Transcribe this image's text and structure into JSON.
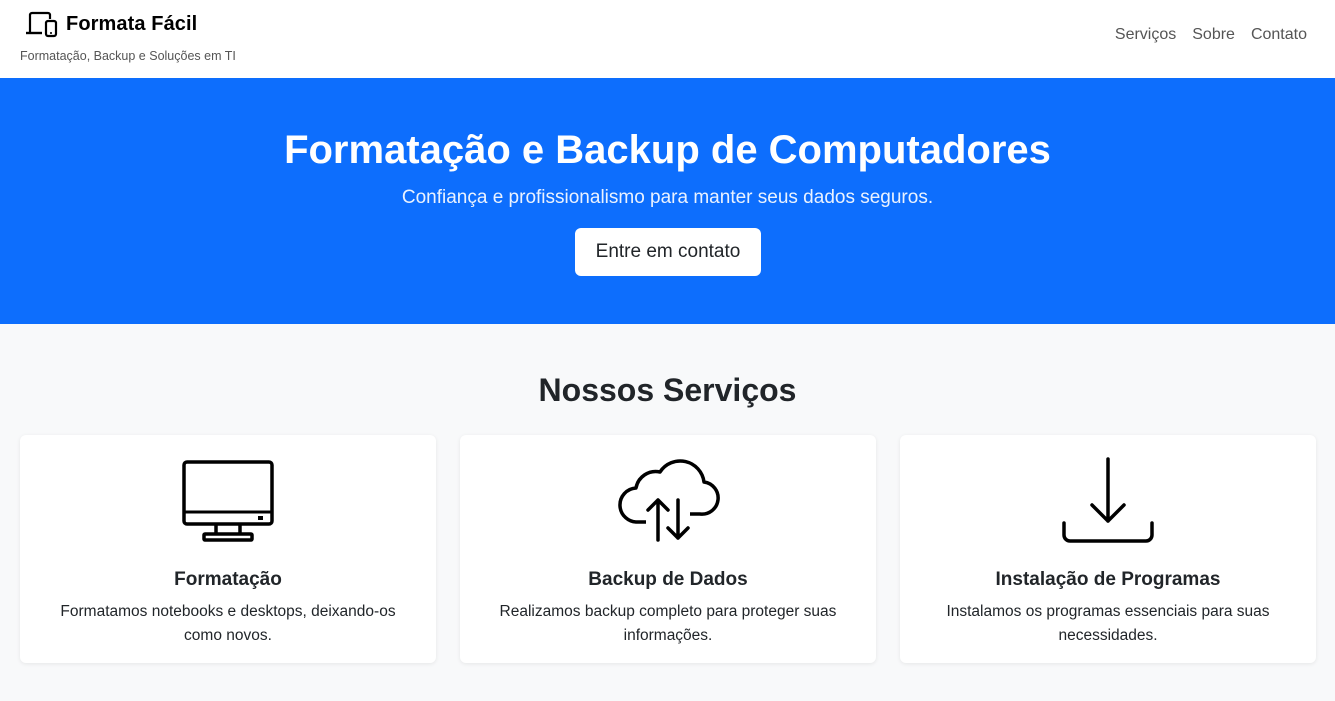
{
  "header": {
    "brand_name": "Formata Fácil",
    "brand_icon": "devices-icon",
    "tagline": "Formatação, Backup e Soluções em TI",
    "nav": [
      {
        "label": "Serviços"
      },
      {
        "label": "Sobre"
      },
      {
        "label": "Contato"
      }
    ]
  },
  "hero": {
    "title": "Formatação e Backup de Computadores",
    "subtitle": "Confiança e profissionalismo para manter seus dados seguros.",
    "cta_label": "Entre em contato",
    "background_color": "#0d6efd"
  },
  "services": {
    "title": "Nossos Serviços",
    "cards": [
      {
        "icon": "display-icon",
        "title": "Formatação",
        "text": "Formatamos notebooks e desktops, deixando-os como novos."
      },
      {
        "icon": "cloud-arrow-up-down-icon",
        "title": "Backup de Dados",
        "text": "Realizamos backup completo para proteger suas informações."
      },
      {
        "icon": "download-icon",
        "title": "Instalação de Programas",
        "text": "Instalamos os programas essenciais para suas necessidades."
      }
    ]
  }
}
